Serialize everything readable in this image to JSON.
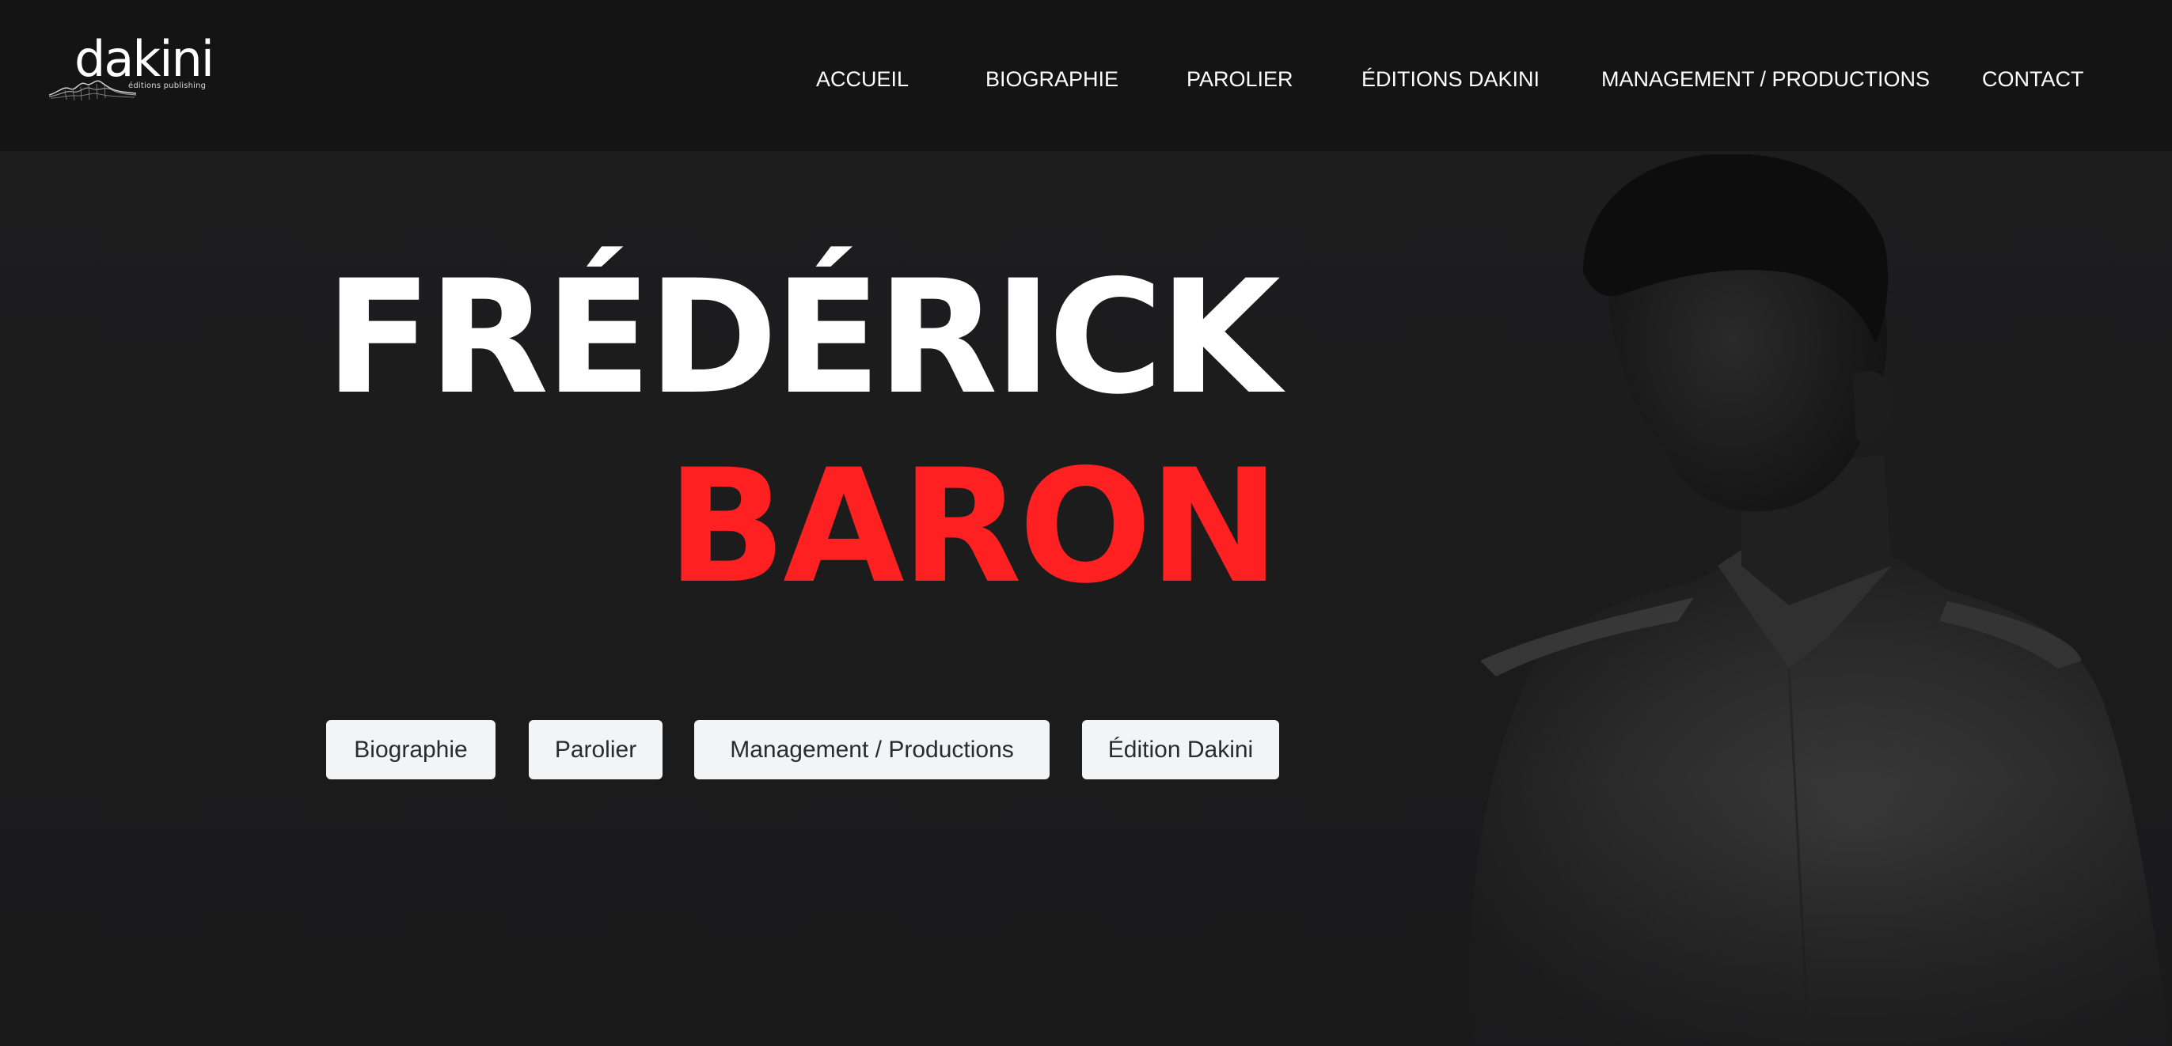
{
  "logo": {
    "wordmark": "dakini",
    "tagline": "éditions publishing"
  },
  "nav": {
    "items": [
      {
        "label": "ACCUEIL"
      },
      {
        "label": "BIOGRAPHIE"
      },
      {
        "label": "PAROLIER"
      },
      {
        "label": "ÉDITIONS DAKINI"
      },
      {
        "label": "MANAGEMENT / PRODUCTIONS"
      },
      {
        "label": "CONTACT"
      }
    ]
  },
  "hero": {
    "first_name": "FRÉDÉRICK",
    "last_name": "BARON",
    "buttons": [
      {
        "label": "Biographie"
      },
      {
        "label": "Parolier"
      },
      {
        "label": "Management / Productions"
      },
      {
        "label": "Édition Dakini"
      }
    ]
  },
  "colors": {
    "header_bg": "#141414",
    "hero_bg": "#1a1a1b",
    "accent_red": "#ff2121",
    "button_bg": "#f3f4f6",
    "text_light": "#ffffff"
  },
  "icons": {
    "logo_wave": "sound-wave-icon"
  }
}
